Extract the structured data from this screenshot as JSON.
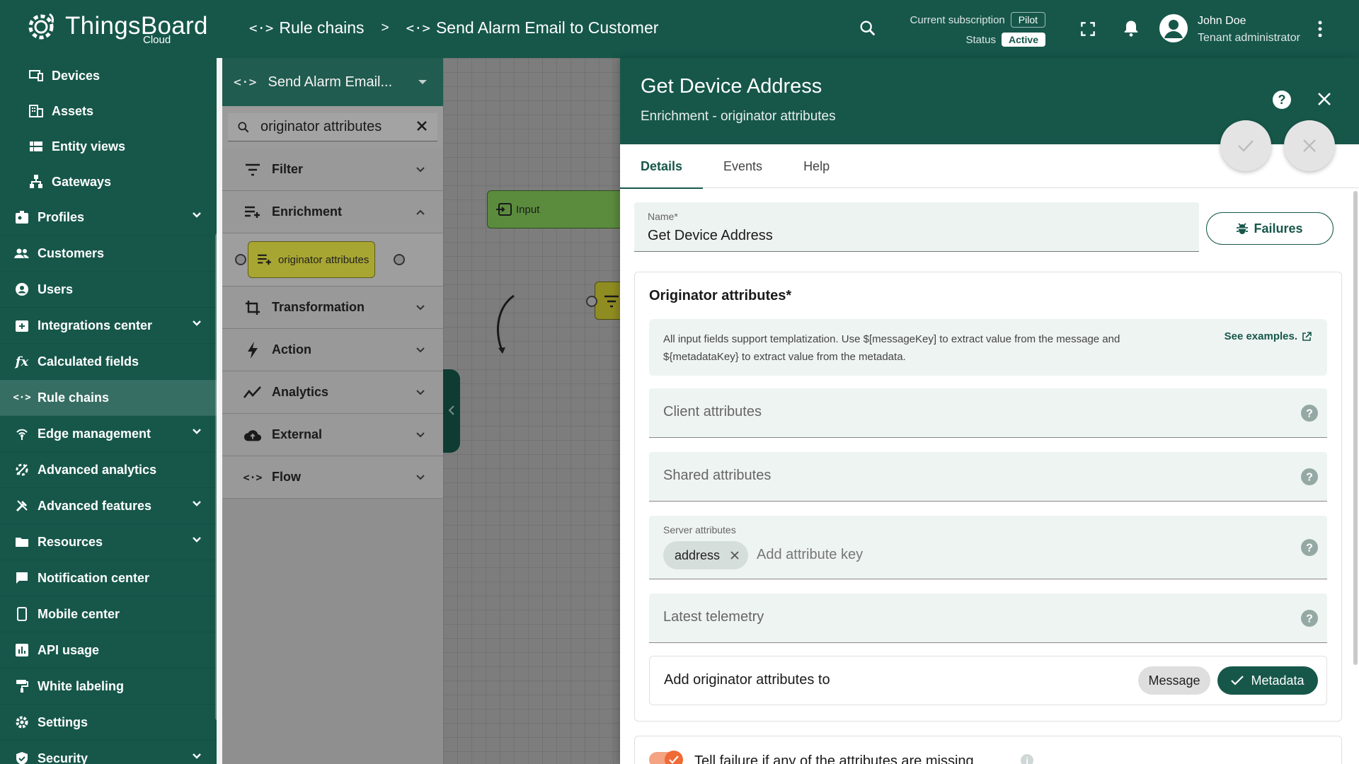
{
  "app": {
    "brand": "ThingsBoard",
    "brand_sub": "Cloud"
  },
  "breadcrumb": {
    "items": [
      {
        "label": "Rule chains"
      },
      {
        "label": "Send Alarm Email to Customer"
      }
    ],
    "separator": ">"
  },
  "subscription": {
    "label": "Current subscription",
    "plan": "Pilot",
    "status_label": "Status",
    "status": "Active"
  },
  "user": {
    "name": "John Doe",
    "role": "Tenant administrator"
  },
  "sidebar": {
    "items": [
      {
        "label": "Devices",
        "icon": "devices-icon",
        "sub": true
      },
      {
        "label": "Assets",
        "icon": "assets-icon",
        "sub": true
      },
      {
        "label": "Entity views",
        "icon": "entity-views-icon",
        "sub": true
      },
      {
        "label": "Gateways",
        "icon": "gateways-icon",
        "sub": true
      },
      {
        "label": "Profiles",
        "icon": "profiles-icon",
        "expandable": true
      },
      {
        "label": "Customers",
        "icon": "customers-icon"
      },
      {
        "label": "Users",
        "icon": "users-icon"
      },
      {
        "label": "Integrations center",
        "icon": "integrations-icon",
        "expandable": true
      },
      {
        "label": "Calculated fields",
        "icon": "function-icon"
      },
      {
        "label": "Rule chains",
        "icon": "rule-chains-icon",
        "active": true
      },
      {
        "label": "Edge management",
        "icon": "edge-icon",
        "expandable": true
      },
      {
        "label": "Advanced analytics",
        "icon": "analytics-icon"
      },
      {
        "label": "Advanced features",
        "icon": "tools-icon",
        "expandable": true
      },
      {
        "label": "Resources",
        "icon": "folder-icon",
        "expandable": true
      },
      {
        "label": "Notification center",
        "icon": "notification-icon"
      },
      {
        "label": "Mobile center",
        "icon": "mobile-icon"
      },
      {
        "label": "API usage",
        "icon": "chart-icon"
      },
      {
        "label": "White labeling",
        "icon": "paint-icon"
      },
      {
        "label": "Settings",
        "icon": "gear-icon"
      },
      {
        "label": "Security",
        "icon": "shield-icon",
        "expandable": true
      }
    ]
  },
  "library": {
    "chain_name": "Send Alarm Email...",
    "search_value": "originator attributes",
    "node_label": "originator attributes",
    "categories": [
      {
        "label": "Filter",
        "icon": "filter-icon"
      },
      {
        "label": "Enrichment",
        "icon": "enrichment-icon",
        "expanded": true
      },
      {
        "label": "Transformation",
        "icon": "crop-icon"
      },
      {
        "label": "Action",
        "icon": "bolt-icon"
      },
      {
        "label": "Analytics",
        "icon": "trend-icon"
      },
      {
        "label": "External",
        "icon": "cloud-upload-icon"
      },
      {
        "label": "Flow",
        "icon": "flow-icon"
      }
    ]
  },
  "canvas": {
    "input_label": "Input"
  },
  "panel": {
    "title": "Get Device Address",
    "subtitle": "Enrichment - originator attributes",
    "tabs": [
      {
        "label": "Details",
        "active": true
      },
      {
        "label": "Events"
      },
      {
        "label": "Help"
      }
    ],
    "name_label": "Name*",
    "name_value": "Get Device Address",
    "failures_label": "Failures",
    "section_title": "Originator attributes*",
    "info_text": "All input fields support templatization. Use $[messageKey] to extract value from the message and ${metadataKey} to extract value from the metadata.",
    "see_examples": "See examples.",
    "client_attributes": "Client attributes",
    "shared_attributes": "Shared attributes",
    "server_attributes_label": "Server attributes",
    "server_chip": "address",
    "add_key_placeholder": "Add attribute key",
    "latest_telemetry": "Latest telemetry",
    "add_to_label": "Add originator attributes to",
    "opt_message": "Message",
    "opt_metadata": "Metadata",
    "tell_failure": "Tell failure if any of the attributes are missing"
  },
  "colors": {
    "primary": "#16574a",
    "node": "#a8a632",
    "input_node": "#5b8c3e",
    "toggle": "#f06a35"
  }
}
